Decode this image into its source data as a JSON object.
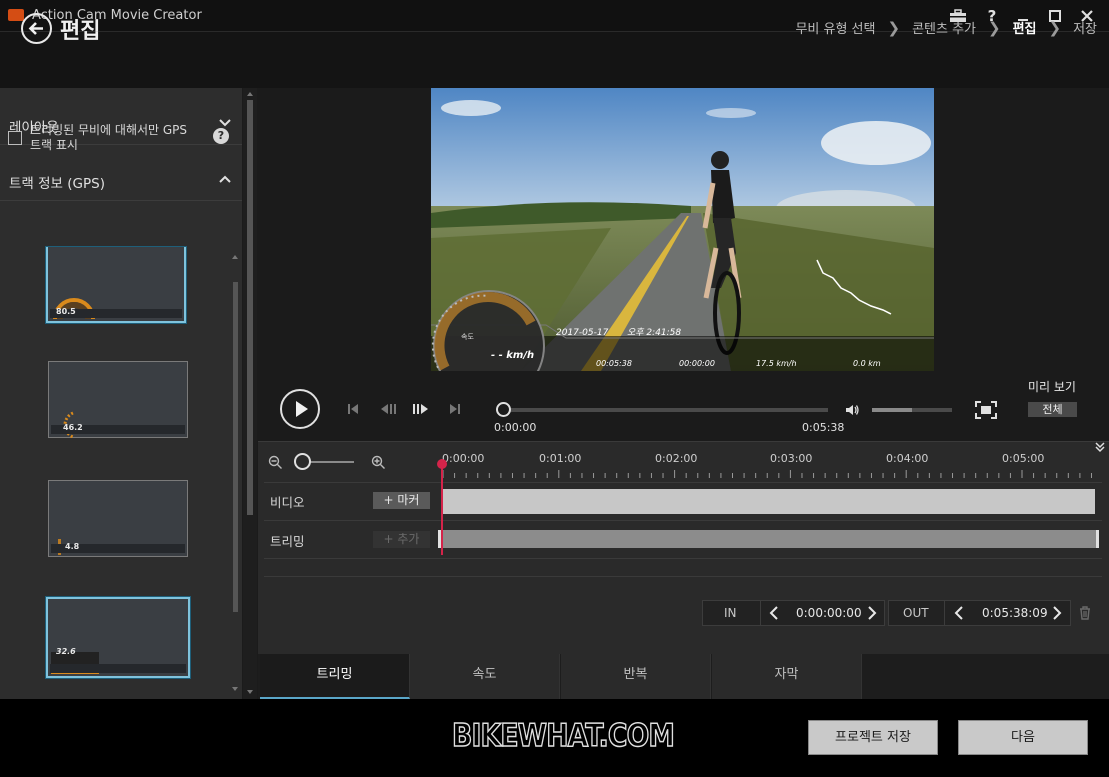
{
  "app": {
    "title": "Action Cam Movie Creator",
    "logo_color": "#d44d14"
  },
  "window_controls": {
    "toolbox_icon": "toolbox-icon",
    "help": "?",
    "minimize": "—",
    "maximize": "☐",
    "close": "✕"
  },
  "header": {
    "title": "편집",
    "breadcrumb": [
      {
        "label": "무비 유형 선택",
        "active": false
      },
      {
        "label": "콘텐츠 추가",
        "active": false
      },
      {
        "label": "편집",
        "active": true
      },
      {
        "label": "저장",
        "active": false
      }
    ]
  },
  "sidebar": {
    "layout_section": "레이아웃",
    "gps_section": "트랙 정보 (GPS)",
    "gps_checkbox_label": "트리밍된 무비에 대해서만 GPS 트랙 표시",
    "gps_checkbox_checked": false,
    "help": "?",
    "templates": [
      {
        "value": "80.5",
        "selected": true
      },
      {
        "value": "46.2",
        "selected": false
      },
      {
        "value": "4.8",
        "selected": false
      },
      {
        "value": "32.6",
        "selected": true
      }
    ]
  },
  "preview_overlay": {
    "date": "2017-05-17",
    "time": "오후 2:41:58",
    "speed_unit": "- - km/h",
    "speed_label": "속도",
    "elapsed": "00:05:38",
    "stop_time": "00:00:00",
    "avg_speed": "17.5 km/h",
    "distance": "0.0 km"
  },
  "player": {
    "current_time": "0:00:00",
    "total_time": "0:05:38",
    "progress": 0.0,
    "volume": 0.5,
    "preview_label": "미리 보기",
    "preview_all": "전체"
  },
  "timeline": {
    "ticks": [
      "0:00:00",
      "0:01:00",
      "0:02:00",
      "0:03:00",
      "0:04:00",
      "0:05:00"
    ],
    "tracks": [
      {
        "label": "비디오",
        "button": "+ 마커"
      },
      {
        "label": "트리밍",
        "button": "+ 추가"
      }
    ]
  },
  "in_out": {
    "in_label": "IN",
    "in_time": "0:00:00:00",
    "out_label": "OUT",
    "out_time": "0:05:38:09"
  },
  "tabs": [
    "트리밍",
    "속도",
    "반복",
    "자막"
  ],
  "active_tab": "트리밍",
  "footer": {
    "watermark": "BIKEWHAT.COM",
    "save_project": "프로젝트 저장",
    "next": "다음"
  }
}
